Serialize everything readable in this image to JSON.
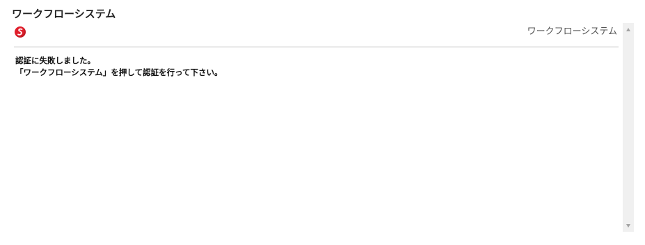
{
  "page": {
    "title": "ワークフローシステム"
  },
  "frame": {
    "logo_icon": "workflow-logo-icon",
    "system_label": "ワークフローシステム",
    "message_lines": [
      "認証に失敗しました。",
      "「ワークフローシステム」を押して認証を行って下さい。"
    ]
  },
  "scrollbar": {
    "up_icon": "scroll-up-arrow-icon",
    "down_icon": "scroll-down-arrow-icon"
  },
  "colors": {
    "logo_red": "#e01e2b",
    "divider": "#bdbdbd",
    "scrollbar_track": "#f0f0f0",
    "scroll_arrow": "#a3a3a3"
  }
}
